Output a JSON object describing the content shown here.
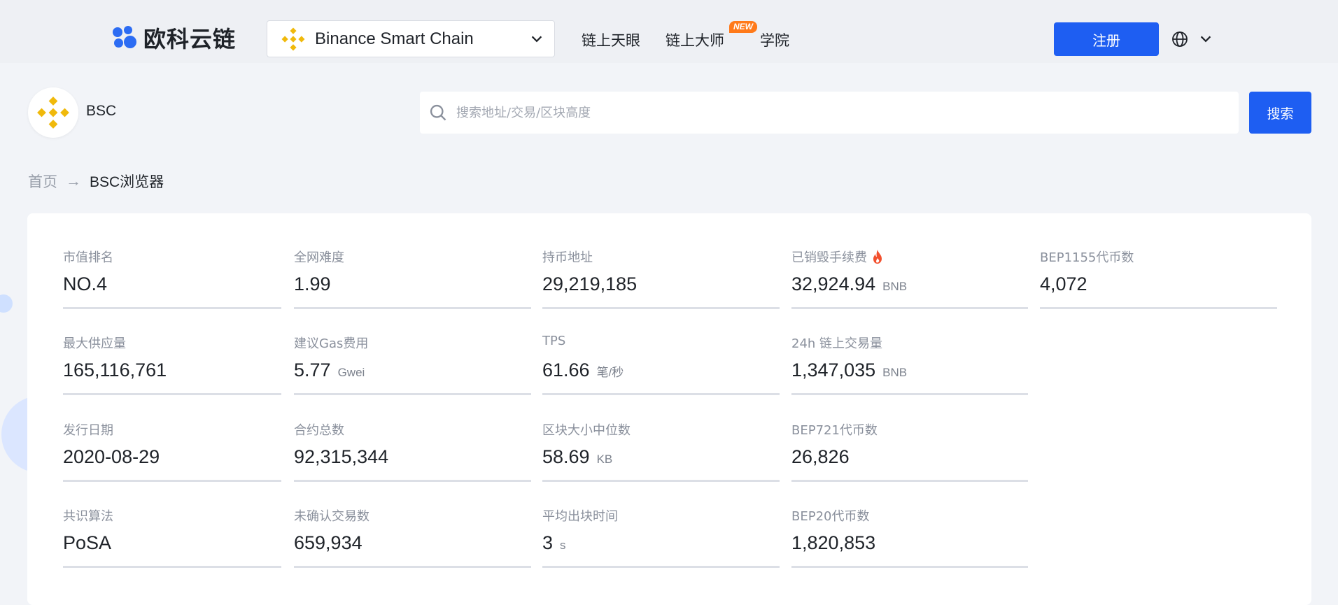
{
  "header": {
    "brand": "欧科云链",
    "chain_selector": {
      "value": "Binance Smart Chain"
    },
    "nav": [
      {
        "label": "链上天眼"
      },
      {
        "label": "链上大师",
        "badge": "NEW"
      },
      {
        "label": "学院"
      }
    ],
    "register_label": "注册",
    "language_icon": "globe-icon"
  },
  "chain": {
    "name": "BSC",
    "icon": "binance-icon"
  },
  "search": {
    "placeholder": "搜索地址/交易/区块高度",
    "button_label": "搜索"
  },
  "breadcrumb": {
    "home": "首页",
    "separator": "→",
    "current": "BSC浏览器"
  },
  "colors": {
    "accent": "#1e5ef2",
    "binance_yellow": "#f0b90b",
    "new_badge": "#ff7a1a",
    "fire": "#f2502e"
  },
  "stats": [
    {
      "label": "市值排名",
      "value": "NO.4",
      "unit": ""
    },
    {
      "label": "全网难度",
      "value": "1.99",
      "unit": ""
    },
    {
      "label": "持币地址",
      "value": "29,219,185",
      "unit": ""
    },
    {
      "label": "已销毁手续费",
      "value": "32,924.94",
      "unit": "BNB",
      "icon": "fire-icon"
    },
    {
      "label": "BEP1155代币数",
      "value": "4,072",
      "unit": ""
    },
    {
      "label": "最大供应量",
      "value": "165,116,761",
      "unit": ""
    },
    {
      "label": "建议Gas费用",
      "value": "5.77",
      "unit": "Gwei"
    },
    {
      "label": "TPS",
      "value": "61.66",
      "unit": "笔/秒"
    },
    {
      "label": "24h 链上交易量",
      "value": "1,347,035",
      "unit": "BNB"
    },
    {
      "label": "发行日期",
      "value": "2020-08-29",
      "unit": ""
    },
    {
      "label": "合约总数",
      "value": "92,315,344",
      "unit": ""
    },
    {
      "label": "区块大小中位数",
      "value": "58.69",
      "unit": "KB"
    },
    {
      "label": "BEP721代币数",
      "value": "26,826",
      "unit": ""
    },
    {
      "label": "共识算法",
      "value": "PoSA",
      "unit": ""
    },
    {
      "label": "未确认交易数",
      "value": "659,934",
      "unit": ""
    },
    {
      "label": "平均出块时间",
      "value": "3",
      "unit": "s"
    },
    {
      "label": "BEP20代币数",
      "value": "1,820,853",
      "unit": ""
    }
  ]
}
